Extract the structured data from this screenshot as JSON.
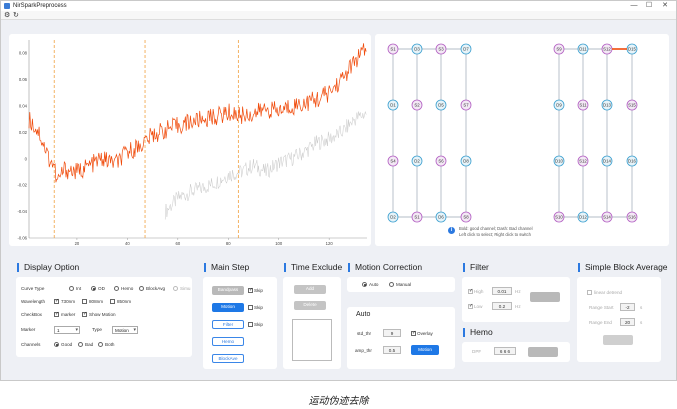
{
  "window": {
    "title": "NirSparkPreprocess",
    "controls": {
      "minimize": "—",
      "maximize": "☐",
      "close": "✕"
    }
  },
  "toolbar": {
    "icons": [
      "settings-icon",
      "refresh-icon"
    ],
    "glyphs": [
      "⚙",
      "↻"
    ]
  },
  "chart_data": {
    "type": "line",
    "x_range": [
      1,
      135
    ],
    "ylim": [
      -0.06,
      0.09
    ],
    "xticks": [
      20,
      40,
      60,
      80,
      100,
      120
    ],
    "yticks": [
      "0.08",
      "0.06",
      "0.04",
      "0.02",
      "0",
      "-0.02",
      "-0.04",
      "-0.06"
    ],
    "markers_x": [
      11,
      47,
      84
    ],
    "series": [
      {
        "color": "#f04a0a",
        "points": [
          [
            1,
            0.03
          ],
          [
            5,
            0.02
          ],
          [
            9,
            0.0
          ],
          [
            11,
            -0.005
          ],
          [
            12,
            -0.018
          ],
          [
            15,
            -0.008
          ],
          [
            20,
            -0.01
          ],
          [
            25,
            -0.005
          ],
          [
            30,
            0.0
          ],
          [
            33,
            -0.002
          ],
          [
            36,
            -0.003
          ],
          [
            40,
            0.005
          ],
          [
            45,
            0.01
          ],
          [
            50,
            0.018
          ],
          [
            55,
            0.022
          ],
          [
            60,
            0.025
          ],
          [
            65,
            0.028
          ],
          [
            70,
            0.03
          ],
          [
            75,
            0.032
          ],
          [
            80,
            0.035
          ],
          [
            85,
            0.033
          ],
          [
            90,
            0.034
          ],
          [
            95,
            0.038
          ],
          [
            100,
            0.036
          ],
          [
            105,
            0.04
          ],
          [
            110,
            0.042
          ],
          [
            115,
            0.045
          ],
          [
            120,
            0.05
          ],
          [
            125,
            0.06
          ],
          [
            128,
            0.068
          ],
          [
            132,
            0.078
          ],
          [
            135,
            0.083
          ]
        ]
      },
      {
        "color": "#c8c8c8",
        "points": [
          [
            55,
            -0.04
          ],
          [
            60,
            -0.03
          ],
          [
            65,
            -0.025
          ],
          [
            70,
            -0.022
          ],
          [
            75,
            -0.018
          ],
          [
            80,
            -0.012
          ],
          [
            85,
            -0.01
          ],
          [
            90,
            -0.005
          ],
          [
            95,
            -0.01
          ],
          [
            100,
            -0.003
          ],
          [
            105,
            0.0
          ],
          [
            110,
            0.005
          ],
          [
            115,
            0.012
          ],
          [
            120,
            0.015
          ],
          [
            125,
            0.02
          ],
          [
            130,
            0.03
          ],
          [
            135,
            0.035
          ]
        ]
      }
    ]
  },
  "channel_map": {
    "left_rows": [
      [
        "S1",
        "D3",
        "S3",
        "D7"
      ],
      [
        "D1",
        "S2",
        "D5",
        "S7"
      ],
      [
        "S4",
        "D2",
        "S6",
        "D8"
      ],
      [
        "D2",
        "S1",
        "D6",
        "S8"
      ]
    ],
    "right_rows": [
      [
        "S9",
        "D11",
        "S12",
        "D15"
      ],
      [
        "D9",
        "S11",
        "D13",
        "S15"
      ],
      [
        "D10",
        "S12",
        "D14",
        "D16"
      ],
      [
        "S10",
        "D12",
        "S14",
        "S16"
      ]
    ],
    "legend_line1": "Bold: good channel; Dash: Bad channel",
    "legend_line2": "Left click to select; Right click to switch",
    "info_icon": "i"
  },
  "display_option": {
    "title": "Display Option",
    "curve_type_label": "Curve Type",
    "curve_types": [
      "Int",
      "OD",
      "Hemo",
      "BlockAvg",
      "Simu"
    ],
    "wavelength_label": "Wavelength",
    "wavelengths": [
      "730nm",
      "808nm",
      "850nm"
    ],
    "check_box_label": "CheckBox",
    "check_items": [
      "marker",
      "Show Motion"
    ],
    "marker_label": "Marker",
    "marker_value": "1",
    "type_label": "Type",
    "type_value": "Motion",
    "channels_label": "Channels",
    "channel_options": [
      "Good",
      "Bad",
      "Both"
    ]
  },
  "main_step": {
    "title": "Main Step",
    "buttons": [
      "Bandpass",
      "Motion",
      "Filter",
      "Hemo",
      "BlockAve"
    ],
    "skip_label": "Skip"
  },
  "time_exclude": {
    "title": "Time Exclude",
    "add": "Add",
    "delete": "Delete"
  },
  "motion_correction": {
    "title": "Motion Correction",
    "modes": [
      "Auto",
      "Manual"
    ],
    "auto_title": "Auto",
    "std_label": "std_thr",
    "std_value": "9",
    "amp_label": "amp_thr",
    "amp_value": "0.5",
    "overlay_label": "Overlay",
    "motion_button": "Motion"
  },
  "filter": {
    "title": "Filter",
    "high_label": "High",
    "high_value": "0.01",
    "high_unit": "Hz",
    "low_label": "Low",
    "low_value": "0.2",
    "low_unit": "Hz"
  },
  "hemo": {
    "title": "Hemo",
    "dpf_label": "DPF",
    "dpf_value": "6  6  6"
  },
  "block_average": {
    "title": "Simple Block Average",
    "linear_label": "linear detrend",
    "start_label": "Range Start",
    "start_value": "-2",
    "start_unit": "s",
    "end_label": "Range End",
    "end_value": "20",
    "end_unit": "s"
  },
  "caption": "运动伪迹去除"
}
